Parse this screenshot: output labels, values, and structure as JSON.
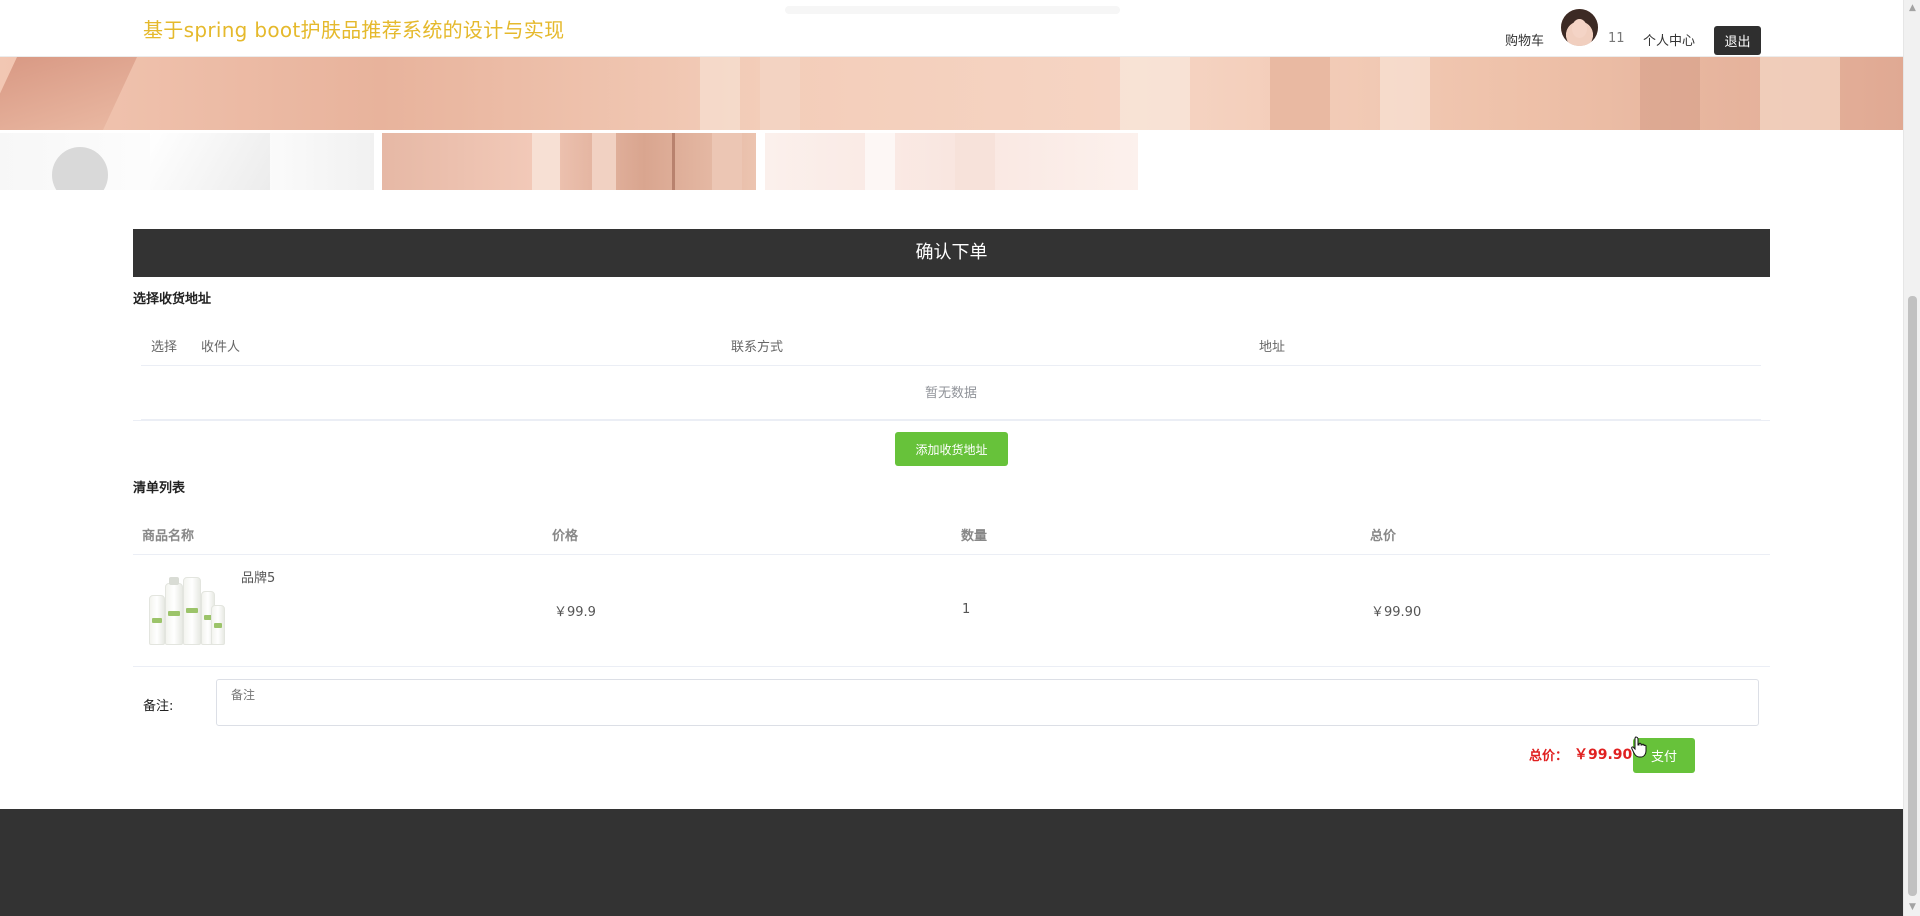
{
  "header": {
    "site_title": "基于spring boot护肤品推荐系统的设计与实现",
    "cart_label": "购物车",
    "count": "11",
    "profile_label": "个人中心",
    "logout_label": "退出"
  },
  "main": {
    "confirm_title": "确认下单",
    "address": {
      "section_title": "选择收货地址",
      "columns": [
        "选择",
        "收件人",
        "联系方式",
        "地址"
      ],
      "empty_text": "暂无数据",
      "add_button_label": "添加收货地址"
    },
    "order_list": {
      "section_title": "清单列表",
      "columns": [
        "商品名称",
        "价格",
        "数量",
        "总价"
      ],
      "rows": [
        {
          "name": "品牌5",
          "price": "￥99.9",
          "quantity": "1",
          "total": "￥99.90",
          "image": "skincare-product-image"
        }
      ]
    },
    "remark": {
      "label": "备注:",
      "placeholder": "备注",
      "value": ""
    },
    "total": {
      "label": "总价：",
      "value": "￥99.90"
    },
    "pay_button_label": "支付"
  },
  "colors": {
    "title": "#e5b92c",
    "dark_bar": "#333333",
    "green_button": "#67c23a",
    "total_red": "#e02020"
  }
}
